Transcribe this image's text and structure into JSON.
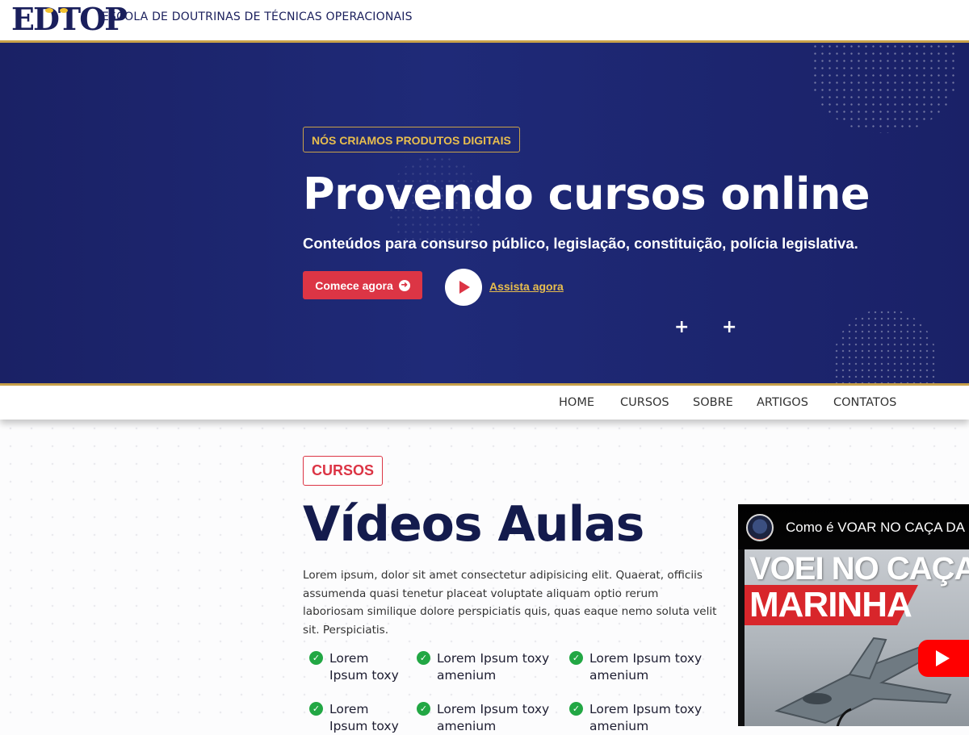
{
  "header": {
    "logo_text": "EDTOP",
    "org_name": "ESCOLA DE DOUTRINAS DE TÉCNICAS OPERACIONAIS"
  },
  "hero": {
    "badge": "NÓS CRIAMOS PRODUTOS DIGITAIS",
    "title": "Provendo cursos online",
    "subtitle": "Conteúdos para consurso público, legislação, constituição, polícia legislativa.",
    "start_button": "Comece agora",
    "start_button_icon": "arrow-circle-right-icon",
    "watch_link": "Assista agora",
    "plus_1": "+",
    "plus_2": "+"
  },
  "nav": {
    "items": [
      {
        "label": "HOME"
      },
      {
        "label": "CURSOS"
      },
      {
        "label": "SOBRE"
      },
      {
        "label": "ARTIGOS"
      },
      {
        "label": "CONTATOS"
      }
    ]
  },
  "courses": {
    "badge": "CURSOS",
    "title": "Vídeos Aulas",
    "description": "Lorem ipsum, dolor sit amet consectetur adipisicing elit. Quaerat, officiis assumenda quasi tenetur placeat voluptate aliquam optio rerum laboriosam similique dolore perspiciatis quis, quas eaque nemo soluta velit sit. Perspiciatis.",
    "features": [
      "Lorem Ipsum toxy",
      "Lorem Ipsum toxy amenium",
      "Lorem Ipsum toxy amenium",
      "Lorem Ipsum toxy",
      "Lorem Ipsum toxy amenium",
      "Lorem Ipsum toxy amenium"
    ],
    "check_icon": "check-circle-icon"
  },
  "video": {
    "title": "Como é VOAR NO CAÇA DA MARINHA",
    "thumb_line1": "VOEI NO CAÇA DA",
    "thumb_line2": "MARINHA",
    "play_icon": "youtube-play-icon"
  },
  "colors": {
    "navy": "#1a2165",
    "gold": "#c9a24a",
    "accent_red": "#dc3545",
    "check_green": "#22a744",
    "youtube_red": "#ff0000"
  }
}
